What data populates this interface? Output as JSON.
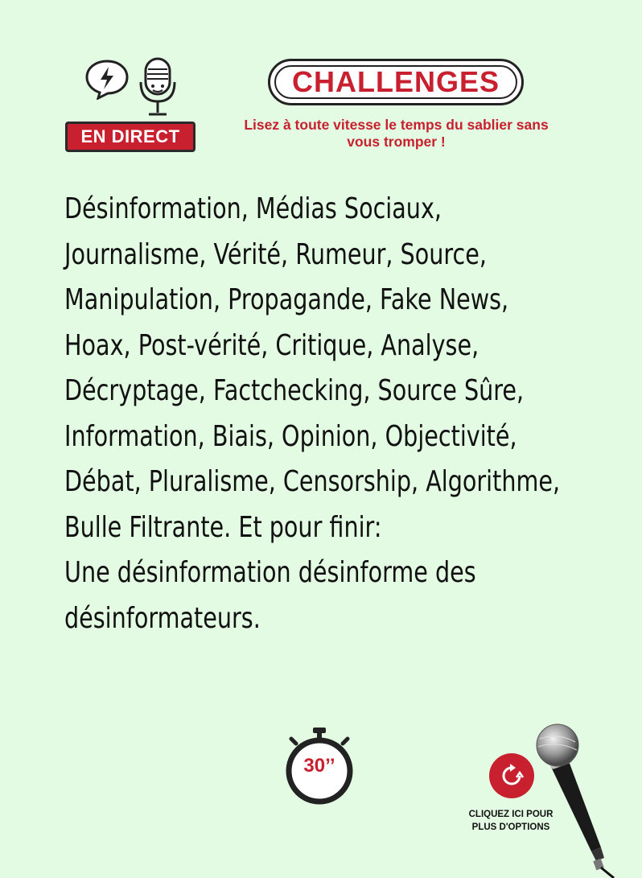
{
  "header": {
    "live_badge": "EN DIRECT",
    "challenge_title": "CHALLENGES",
    "challenge_instructions": "Lisez à toute vitesse le temps du sablier sans vous tromper !"
  },
  "main": {
    "lines": [
      "Désinformation, Médias Sociaux,",
      "Journalisme, Vérité, Rumeur, Source,",
      "Manipulation, Propagande, Fake News,",
      "Hoax, Post-vérité, Critique, Analyse,",
      "Décryptage, Factchecking, Source Sûre,",
      "Information, Biais, Opinion, Objectivité,",
      "Débat, Pluralisme, Censorship, Algorithme,",
      "Bulle Filtrante. Et pour finir:",
      "Une désinformation désinforme des",
      "désinformateurs."
    ]
  },
  "footer": {
    "timer_label": "30’’",
    "options_line1": "CLIQUEZ ICI POUR",
    "options_line2": "PLUS D'OPTIONS"
  },
  "colors": {
    "background": "#e3fbe3",
    "accent_red": "#c8202e",
    "text": "#111111"
  },
  "icons": [
    "speech-bubble-lightning-icon",
    "podcast-microphone-icon",
    "stopwatch-icon",
    "refresh-icon",
    "handheld-microphone-icon"
  ]
}
